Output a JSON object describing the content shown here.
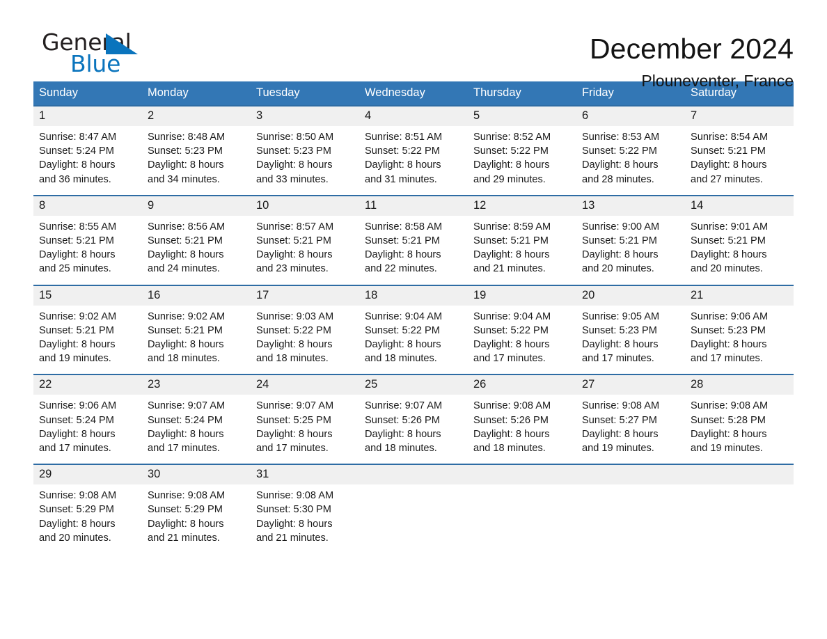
{
  "brand": {
    "name_part1": "General",
    "name_part2": "Blue",
    "triangle_color": "#0a74bd",
    "text_color": "#231f20"
  },
  "header": {
    "title": "December 2024",
    "subtitle": "Plouneventer, France"
  },
  "theme": {
    "header_blue": "#3377b5",
    "row_rule_blue": "#2e6ca4",
    "daynum_band": "#f0f0f0"
  },
  "calendar": {
    "weekday_headers": [
      "Sunday",
      "Monday",
      "Tuesday",
      "Wednesday",
      "Thursday",
      "Friday",
      "Saturday"
    ],
    "weeks": [
      [
        {
          "day": "1",
          "sunrise": "Sunrise: 8:47 AM",
          "sunset": "Sunset: 5:24 PM",
          "daylight_l1": "Daylight: 8 hours",
          "daylight_l2": "and 36 minutes."
        },
        {
          "day": "2",
          "sunrise": "Sunrise: 8:48 AM",
          "sunset": "Sunset: 5:23 PM",
          "daylight_l1": "Daylight: 8 hours",
          "daylight_l2": "and 34 minutes."
        },
        {
          "day": "3",
          "sunrise": "Sunrise: 8:50 AM",
          "sunset": "Sunset: 5:23 PM",
          "daylight_l1": "Daylight: 8 hours",
          "daylight_l2": "and 33 minutes."
        },
        {
          "day": "4",
          "sunrise": "Sunrise: 8:51 AM",
          "sunset": "Sunset: 5:22 PM",
          "daylight_l1": "Daylight: 8 hours",
          "daylight_l2": "and 31 minutes."
        },
        {
          "day": "5",
          "sunrise": "Sunrise: 8:52 AM",
          "sunset": "Sunset: 5:22 PM",
          "daylight_l1": "Daylight: 8 hours",
          "daylight_l2": "and 29 minutes."
        },
        {
          "day": "6",
          "sunrise": "Sunrise: 8:53 AM",
          "sunset": "Sunset: 5:22 PM",
          "daylight_l1": "Daylight: 8 hours",
          "daylight_l2": "and 28 minutes."
        },
        {
          "day": "7",
          "sunrise": "Sunrise: 8:54 AM",
          "sunset": "Sunset: 5:21 PM",
          "daylight_l1": "Daylight: 8 hours",
          "daylight_l2": "and 27 minutes."
        }
      ],
      [
        {
          "day": "8",
          "sunrise": "Sunrise: 8:55 AM",
          "sunset": "Sunset: 5:21 PM",
          "daylight_l1": "Daylight: 8 hours",
          "daylight_l2": "and 25 minutes."
        },
        {
          "day": "9",
          "sunrise": "Sunrise: 8:56 AM",
          "sunset": "Sunset: 5:21 PM",
          "daylight_l1": "Daylight: 8 hours",
          "daylight_l2": "and 24 minutes."
        },
        {
          "day": "10",
          "sunrise": "Sunrise: 8:57 AM",
          "sunset": "Sunset: 5:21 PM",
          "daylight_l1": "Daylight: 8 hours",
          "daylight_l2": "and 23 minutes."
        },
        {
          "day": "11",
          "sunrise": "Sunrise: 8:58 AM",
          "sunset": "Sunset: 5:21 PM",
          "daylight_l1": "Daylight: 8 hours",
          "daylight_l2": "and 22 minutes."
        },
        {
          "day": "12",
          "sunrise": "Sunrise: 8:59 AM",
          "sunset": "Sunset: 5:21 PM",
          "daylight_l1": "Daylight: 8 hours",
          "daylight_l2": "and 21 minutes."
        },
        {
          "day": "13",
          "sunrise": "Sunrise: 9:00 AM",
          "sunset": "Sunset: 5:21 PM",
          "daylight_l1": "Daylight: 8 hours",
          "daylight_l2": "and 20 minutes."
        },
        {
          "day": "14",
          "sunrise": "Sunrise: 9:01 AM",
          "sunset": "Sunset: 5:21 PM",
          "daylight_l1": "Daylight: 8 hours",
          "daylight_l2": "and 20 minutes."
        }
      ],
      [
        {
          "day": "15",
          "sunrise": "Sunrise: 9:02 AM",
          "sunset": "Sunset: 5:21 PM",
          "daylight_l1": "Daylight: 8 hours",
          "daylight_l2": "and 19 minutes."
        },
        {
          "day": "16",
          "sunrise": "Sunrise: 9:02 AM",
          "sunset": "Sunset: 5:21 PM",
          "daylight_l1": "Daylight: 8 hours",
          "daylight_l2": "and 18 minutes."
        },
        {
          "day": "17",
          "sunrise": "Sunrise: 9:03 AM",
          "sunset": "Sunset: 5:22 PM",
          "daylight_l1": "Daylight: 8 hours",
          "daylight_l2": "and 18 minutes."
        },
        {
          "day": "18",
          "sunrise": "Sunrise: 9:04 AM",
          "sunset": "Sunset: 5:22 PM",
          "daylight_l1": "Daylight: 8 hours",
          "daylight_l2": "and 18 minutes."
        },
        {
          "day": "19",
          "sunrise": "Sunrise: 9:04 AM",
          "sunset": "Sunset: 5:22 PM",
          "daylight_l1": "Daylight: 8 hours",
          "daylight_l2": "and 17 minutes."
        },
        {
          "day": "20",
          "sunrise": "Sunrise: 9:05 AM",
          "sunset": "Sunset: 5:23 PM",
          "daylight_l1": "Daylight: 8 hours",
          "daylight_l2": "and 17 minutes."
        },
        {
          "day": "21",
          "sunrise": "Sunrise: 9:06 AM",
          "sunset": "Sunset: 5:23 PM",
          "daylight_l1": "Daylight: 8 hours",
          "daylight_l2": "and 17 minutes."
        }
      ],
      [
        {
          "day": "22",
          "sunrise": "Sunrise: 9:06 AM",
          "sunset": "Sunset: 5:24 PM",
          "daylight_l1": "Daylight: 8 hours",
          "daylight_l2": "and 17 minutes."
        },
        {
          "day": "23",
          "sunrise": "Sunrise: 9:07 AM",
          "sunset": "Sunset: 5:24 PM",
          "daylight_l1": "Daylight: 8 hours",
          "daylight_l2": "and 17 minutes."
        },
        {
          "day": "24",
          "sunrise": "Sunrise: 9:07 AM",
          "sunset": "Sunset: 5:25 PM",
          "daylight_l1": "Daylight: 8 hours",
          "daylight_l2": "and 17 minutes."
        },
        {
          "day": "25",
          "sunrise": "Sunrise: 9:07 AM",
          "sunset": "Sunset: 5:26 PM",
          "daylight_l1": "Daylight: 8 hours",
          "daylight_l2": "and 18 minutes."
        },
        {
          "day": "26",
          "sunrise": "Sunrise: 9:08 AM",
          "sunset": "Sunset: 5:26 PM",
          "daylight_l1": "Daylight: 8 hours",
          "daylight_l2": "and 18 minutes."
        },
        {
          "day": "27",
          "sunrise": "Sunrise: 9:08 AM",
          "sunset": "Sunset: 5:27 PM",
          "daylight_l1": "Daylight: 8 hours",
          "daylight_l2": "and 19 minutes."
        },
        {
          "day": "28",
          "sunrise": "Sunrise: 9:08 AM",
          "sunset": "Sunset: 5:28 PM",
          "daylight_l1": "Daylight: 8 hours",
          "daylight_l2": "and 19 minutes."
        }
      ],
      [
        {
          "day": "29",
          "sunrise": "Sunrise: 9:08 AM",
          "sunset": "Sunset: 5:29 PM",
          "daylight_l1": "Daylight: 8 hours",
          "daylight_l2": "and 20 minutes."
        },
        {
          "day": "30",
          "sunrise": "Sunrise: 9:08 AM",
          "sunset": "Sunset: 5:29 PM",
          "daylight_l1": "Daylight: 8 hours",
          "daylight_l2": "and 21 minutes."
        },
        {
          "day": "31",
          "sunrise": "Sunrise: 9:08 AM",
          "sunset": "Sunset: 5:30 PM",
          "daylight_l1": "Daylight: 8 hours",
          "daylight_l2": "and 21 minutes."
        },
        {
          "day": "",
          "sunrise": "",
          "sunset": "",
          "daylight_l1": "",
          "daylight_l2": ""
        },
        {
          "day": "",
          "sunrise": "",
          "sunset": "",
          "daylight_l1": "",
          "daylight_l2": ""
        },
        {
          "day": "",
          "sunrise": "",
          "sunset": "",
          "daylight_l1": "",
          "daylight_l2": ""
        },
        {
          "day": "",
          "sunrise": "",
          "sunset": "",
          "daylight_l1": "",
          "daylight_l2": ""
        }
      ]
    ]
  }
}
